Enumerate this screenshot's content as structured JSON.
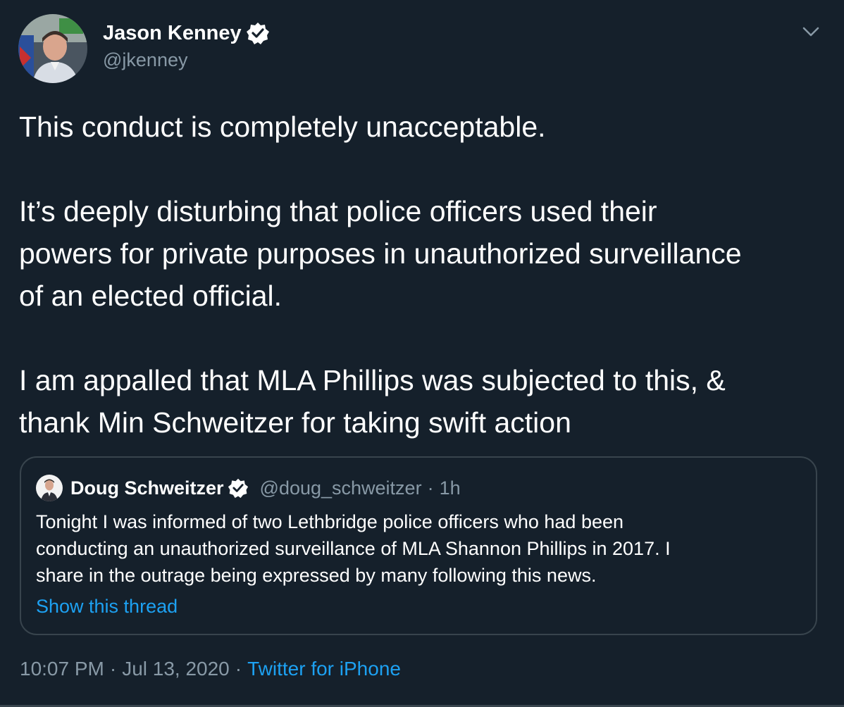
{
  "tweet": {
    "author": {
      "name": "Jason Kenney",
      "handle": "@jkenney",
      "verified": true,
      "avatar_icon": "profile-photo"
    },
    "menu_icon": "chevron-down-icon",
    "paragraphs": [
      [
        "This conduct is completely unacceptable."
      ],
      [
        "It’s deeply disturbing that police officers used their",
        "powers for private purposes in unauthorized surveillance",
        "of an elected official."
      ],
      [
        "I am appalled that MLA Phillips was subjected to this, &",
        "thank Min Schweitzer for taking swift action"
      ]
    ],
    "quoted": {
      "name": "Doug Schweitzer",
      "handle": "@doug_schweitzer",
      "separator": "·",
      "time": "1h",
      "verified": true,
      "body_lines": [
        "Tonight I was informed of two Lethbridge police officers who had been",
        "conducting an unauthorized surveillance of MLA Shannon Phillips in 2017. I",
        "share in the outrage being expressed by many following this news."
      ],
      "show_thread": "Show this thread"
    },
    "meta": {
      "time": "10:07 PM",
      "separator": "·",
      "date": "Jul 13, 2020",
      "source": "Twitter for iPhone"
    }
  },
  "colors": {
    "background": "#15202b",
    "text": "#ffffff",
    "secondary_text": "#8899a6",
    "link": "#1da1f2",
    "border": "#38444d"
  }
}
